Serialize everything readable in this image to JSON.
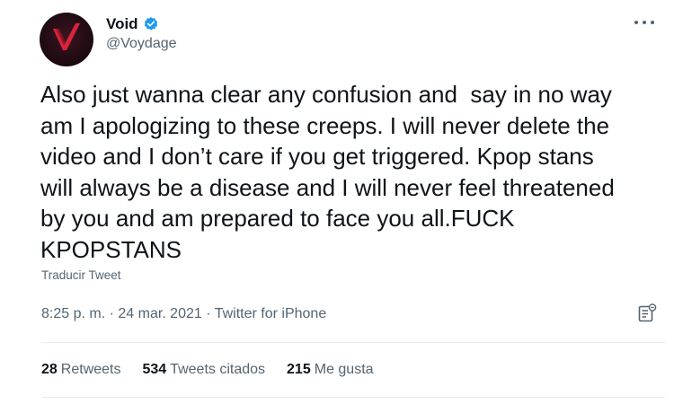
{
  "author": {
    "display_name": "Void",
    "handle": "@Voydage",
    "verified": true,
    "verified_color": "#1d9bf0"
  },
  "tweet": {
    "text": "Also just wanna clear any confusion and  say in no way\nam I apologizing to these creeps. I will never delete the\nvideo and I don’t care if you get triggered. Kpop stans\nwill always be a disease and I will never feel threatened\nby you and am prepared to face you all.FUCK\nKPOPSTANS",
    "translate_label": "Traducir Tweet",
    "time": "8:25 p. m.",
    "separator": " · ",
    "date": "24 mar. 2021",
    "source": "Twitter for iPhone"
  },
  "stats": {
    "retweets_count": "28",
    "retweets_label": "Retweets",
    "quotes_count": "534",
    "quotes_label": "Tweets citados",
    "likes_count": "215",
    "likes_label": "Me gusta"
  },
  "icons": {
    "more": "more-options-icon",
    "analytics": "analytics-icon",
    "verified": "verified-badge-icon",
    "avatar": "avatar-red-checkmark-logo"
  },
  "colors": {
    "text": "#0f1419",
    "secondary": "#536471",
    "avatar_bg": "#1c0a10",
    "avatar_mark": "#d8243c"
  }
}
